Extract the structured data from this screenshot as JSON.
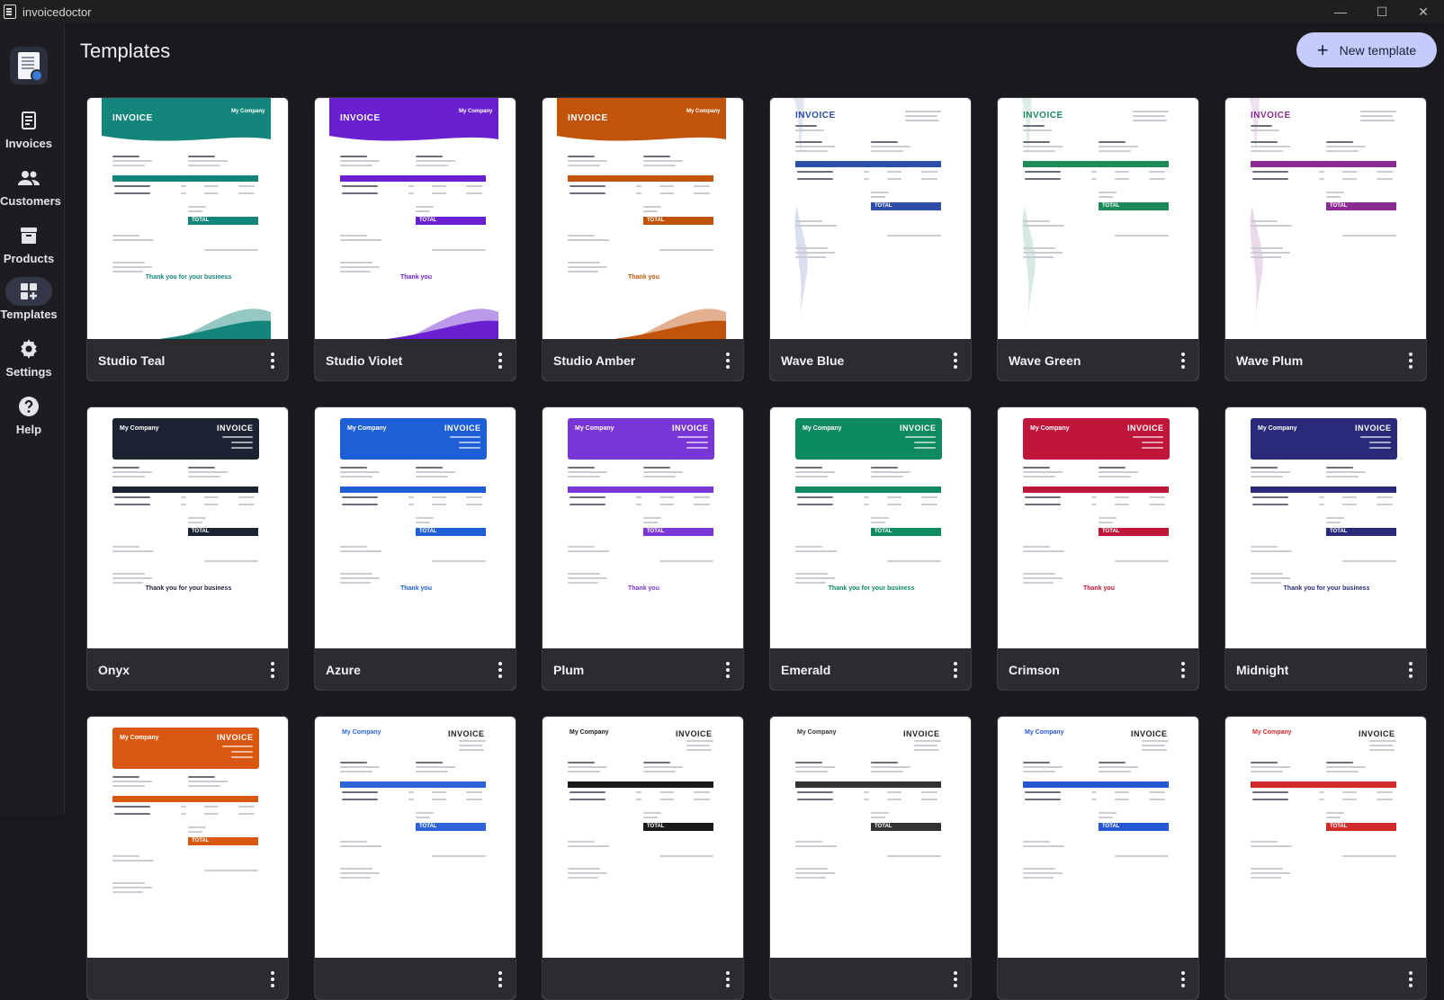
{
  "app": {
    "title": "invoicedoctor"
  },
  "window": {
    "minimize": "—",
    "maximize": "☐",
    "close": "✕"
  },
  "sidebar": {
    "items": [
      {
        "label": "Invoices",
        "icon": "invoice-icon"
      },
      {
        "label": "Customers",
        "icon": "people-icon"
      },
      {
        "label": "Products",
        "icon": "archive-box-icon"
      },
      {
        "label": "Templates",
        "icon": "templates-grid-icon",
        "active": true
      },
      {
        "label": "Settings",
        "icon": "gear-icon"
      },
      {
        "label": "Help",
        "icon": "help-circle-icon"
      }
    ]
  },
  "header": {
    "title": "Templates",
    "new_button": "New template"
  },
  "templates": [
    {
      "name": "Studio Teal",
      "style": "studio",
      "accent": "#14857a",
      "thanks": "Thank you for your business"
    },
    {
      "name": "Studio Violet",
      "style": "studio",
      "accent": "#6a1fd0",
      "thanks": "Thank you"
    },
    {
      "name": "Studio Amber",
      "style": "studio",
      "accent": "#c2530a",
      "thanks": "Thank you"
    },
    {
      "name": "Wave Blue",
      "style": "wave",
      "accent": "#2c4ea8",
      "thanks": ""
    },
    {
      "name": "Wave Green",
      "style": "wave",
      "accent": "#1d8a5a",
      "thanks": ""
    },
    {
      "name": "Wave Plum",
      "style": "wave",
      "accent": "#8a2d92",
      "thanks": ""
    },
    {
      "name": "Onyx",
      "style": "box",
      "accent": "#1c2433",
      "thanks": "Thank you for your business"
    },
    {
      "name": "Azure",
      "style": "box",
      "accent": "#1f5fd6",
      "thanks": "Thank you"
    },
    {
      "name": "Plum",
      "style": "box",
      "accent": "#7a35d6",
      "thanks": "Thank you"
    },
    {
      "name": "Emerald",
      "style": "box",
      "accent": "#0e8a63",
      "thanks": "Thank you for your business"
    },
    {
      "name": "Crimson",
      "style": "box",
      "accent": "#c0153a",
      "thanks": "Thank you"
    },
    {
      "name": "Midnight",
      "style": "box",
      "accent": "#2a2a7a",
      "thanks": "Thank you for your business"
    },
    {
      "name": "",
      "style": "box",
      "accent": "#d9570f",
      "thanks": ""
    },
    {
      "name": "",
      "style": "plain",
      "accent": "#2f64d8",
      "thanks": ""
    },
    {
      "name": "",
      "style": "plain",
      "accent": "#1a1a1a",
      "thanks": ""
    },
    {
      "name": "",
      "style": "plain",
      "accent": "#333333",
      "thanks": ""
    },
    {
      "name": "",
      "style": "plain",
      "accent": "#2456d6",
      "thanks": ""
    },
    {
      "name": "",
      "style": "plain",
      "accent": "#d02a2a",
      "thanks": ""
    }
  ],
  "thumbnail_text": {
    "invoice": "INVOICE",
    "company": "My Company",
    "total": "TOTAL"
  }
}
